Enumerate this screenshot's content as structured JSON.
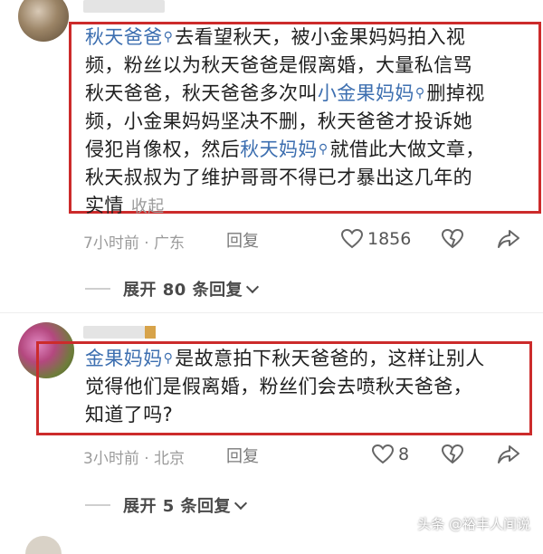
{
  "comments": [
    {
      "body_segments": [
        {
          "text": "秋天爸爸",
          "mention": true
        },
        {
          "text": "去看望秋天，被小金果妈妈拍入视频，粉丝以为秋天爸爸是假离婚，大量私信骂秋天爸爸，秋天爸爸多次叫",
          "mention": false
        },
        {
          "text": "小金果妈妈",
          "mention": true
        },
        {
          "text": "删掉视频，小金果妈妈坚决不删，秋天爸爸才投诉她侵犯肖像权，然后",
          "mention": false
        },
        {
          "text": "秋天妈妈",
          "mention": true
        },
        {
          "text": "就借此大做文章，秋天叔叔为了维护哥哥不得已才暴出这几年的实情",
          "mention": false
        }
      ],
      "lines": [
        [
          {
            "t": "秋天爸爸",
            "m": true
          },
          {
            "t": "去看望秋天，被小金果妈妈拍入视",
            "m": false
          }
        ],
        [
          {
            "t": "频，粉丝以为秋天爸爸是假离婚，大量私信骂",
            "m": false
          }
        ],
        [
          {
            "t": "秋天爸爸，秋天爸爸多次叫",
            "m": false
          },
          {
            "t": "小金果妈妈",
            "m": true
          },
          {
            "t": "删掉视",
            "m": false
          }
        ],
        [
          {
            "t": "频，小金果妈妈坚决不删，秋天爸爸才投诉她",
            "m": false
          }
        ],
        [
          {
            "t": "侵犯肖像权，然后",
            "m": false
          },
          {
            "t": "秋天妈妈",
            "m": true
          },
          {
            "t": "就借此大做文章，",
            "m": false
          }
        ],
        [
          {
            "t": "秋天叔叔为了维护哥哥不得已才暴出这几年的",
            "m": false
          }
        ],
        [
          {
            "t": "实情",
            "m": false
          }
        ]
      ],
      "collapse_label": "收起",
      "meta": "7小时前 · 广东",
      "reply_label": "回复",
      "likes": "1856",
      "expand_label": "展开 80 条回复"
    },
    {
      "lines": [
        [
          {
            "t": "金果妈妈",
            "m": true
          },
          {
            "t": "是故意拍下秋天爸爸的，这样让别人",
            "m": false
          }
        ],
        [
          {
            "t": "觉得他们是假离婚，粉丝们会去喷秋天爸爸，",
            "m": false
          }
        ],
        [
          {
            "t": "知道了吗?",
            "m": false
          }
        ]
      ],
      "meta": "3小时前 · 北京",
      "reply_label": "回复",
      "likes": "8",
      "expand_label": "展开 5 条回复"
    }
  ],
  "watermark": "头条 @裕丰人间说",
  "colors": {
    "mention": "#3d6fb0",
    "highlight": "#cc2b2b",
    "meta": "#9b9b9b"
  },
  "icons": [
    "search-mention-icon",
    "heart-icon",
    "dislike-heart-icon",
    "share-icon",
    "chevron-down-icon"
  ]
}
